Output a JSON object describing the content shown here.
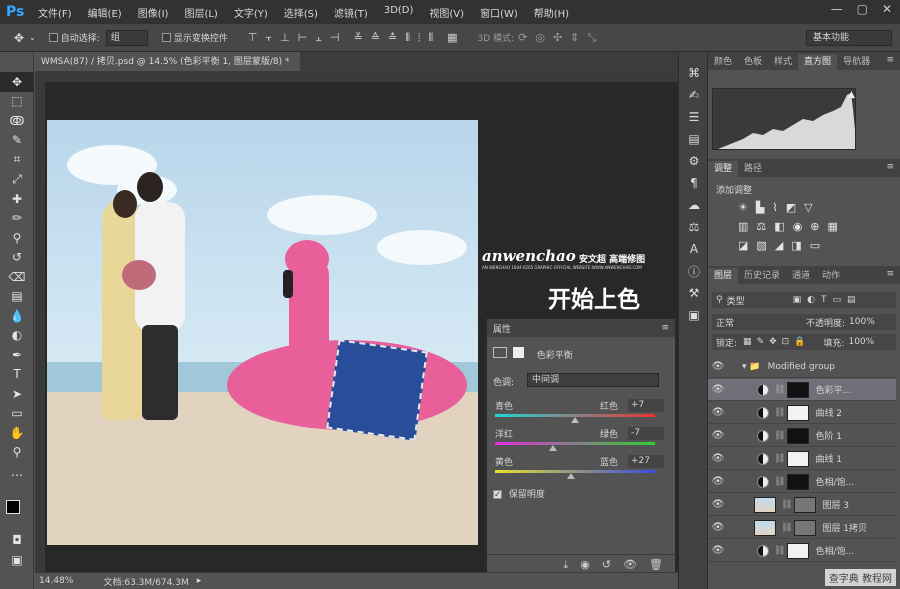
{
  "app": {
    "logo": "Ps"
  },
  "menu": [
    "文件(F)",
    "编辑(E)",
    "图像(I)",
    "图层(L)",
    "文字(Y)",
    "选择(S)",
    "滤镜(T)",
    "3D(D)",
    "视图(V)",
    "窗口(W)",
    "帮助(H)"
  ],
  "window_controls": [
    "—",
    "▢",
    "✕"
  ],
  "options": {
    "auto_select_label": "自动选择:",
    "auto_select_value": "组",
    "show_transform_label": "显示变换控件",
    "mode_3d_label": "3D 模式:",
    "workspace": "基本功能"
  },
  "document": {
    "tab_title": "WMSA(87) / 拷贝.psd @ 14.5% (色彩平衡 1, 图层蒙版/8) *",
    "zoom": "14.48%",
    "doc_size": "文档:63.3M/674.3M"
  },
  "canvas": {
    "brand": "anwenchao",
    "brand_cn": "安文超 高端修图",
    "brand_sub": "AN WENCHAO 1604-0265 GRAPHIC OFFICIAL WEBSITE:WWW.ANWENCHAO.COM",
    "headline": "开始上色"
  },
  "properties": {
    "tab": "属性",
    "title": "色彩平衡",
    "tone_label": "色调:",
    "tone_value": "中间调",
    "sliders": [
      {
        "left": "青色",
        "right": "红色",
        "value": "+7"
      },
      {
        "left": "洋红",
        "right": "绿色",
        "value": "-7"
      },
      {
        "left": "黄色",
        "right": "蓝色",
        "value": "+27"
      }
    ],
    "preserve_luminosity": "保留明度"
  },
  "panels_top": {
    "tabs": [
      "颜色",
      "色板",
      "样式",
      "直方图",
      "导航器"
    ],
    "active": "直方图"
  },
  "adjustments": {
    "tabs": [
      "调整",
      "路径"
    ],
    "add_label": "添加调整"
  },
  "layers": {
    "tabs": [
      "图层",
      "历史记录",
      "通道",
      "动作"
    ],
    "filter_label": "类型",
    "blend_mode": "正常",
    "opacity_label": "不透明度:",
    "opacity_value": "100%",
    "lock_label": "锁定:",
    "fill_label": "填充:",
    "fill_value": "100%",
    "items": [
      {
        "name": "Modified group",
        "kind": "group",
        "selected": false
      },
      {
        "name": "色彩平...",
        "kind": "adjust",
        "selected": true
      },
      {
        "name": "曲线 2",
        "kind": "adjust",
        "selected": false
      },
      {
        "name": "色阶 1",
        "kind": "adjust",
        "selected": false
      },
      {
        "name": "曲线 1",
        "kind": "adjust",
        "selected": false
      },
      {
        "name": "色相/饱...",
        "kind": "adjust",
        "selected": false
      },
      {
        "name": "图层 3",
        "kind": "pixel",
        "selected": false
      },
      {
        "name": "图层 1拷贝",
        "kind": "pixel",
        "selected": false
      },
      {
        "name": "色相/饱...",
        "kind": "adjust",
        "selected": false
      }
    ]
  },
  "site_mark": "查字典 教程网"
}
